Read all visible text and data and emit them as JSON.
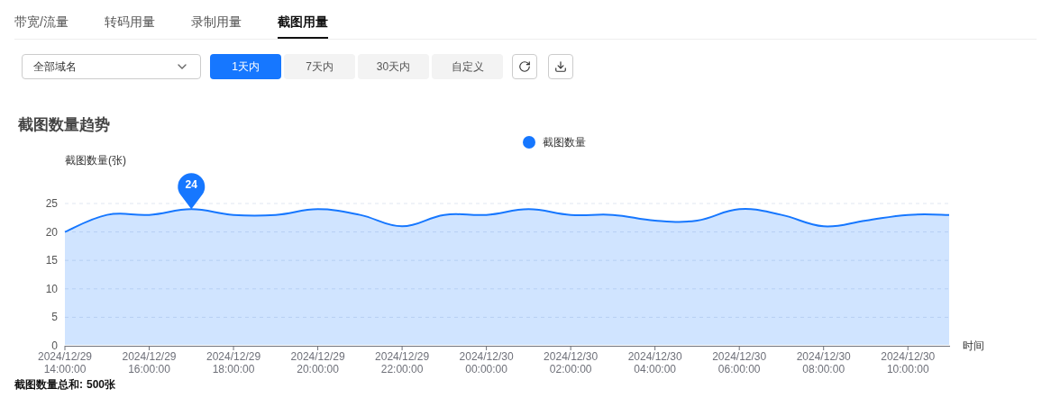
{
  "tabs": [
    {
      "label": "带宽/流量",
      "selected": false
    },
    {
      "label": "转码用量",
      "selected": false
    },
    {
      "label": "录制用量",
      "selected": false
    },
    {
      "label": "截图用量",
      "selected": true
    }
  ],
  "filters": {
    "domain_select": {
      "value": "全部域名"
    },
    "ranges": [
      {
        "label": "1天内",
        "selected": true
      },
      {
        "label": "7天内",
        "selected": false
      },
      {
        "label": "30天内",
        "selected": false
      },
      {
        "label": "自定义",
        "selected": false
      }
    ]
  },
  "chart_section": {
    "title": "截图数量趋势",
    "chart_data": {
      "type": "area",
      "ylabel": "截图数量(张)",
      "xlabel": "时间",
      "categories": [
        "2024/12/29 14:00:00",
        null,
        "2024/12/29 16:00:00",
        null,
        "2024/12/29 18:00:00",
        null,
        "2024/12/29 20:00:00",
        null,
        "2024/12/29 22:00:00",
        null,
        "2024/12/30 00:00:00",
        null,
        "2024/12/30 02:00:00",
        null,
        "2024/12/30 04:00:00",
        null,
        "2024/12/30 06:00:00",
        null,
        "2024/12/30 08:00:00",
        null,
        "2024/12/30 10:00:00",
        null
      ],
      "series": [
        {
          "name": "截图数量",
          "color": "#1677ff",
          "values": [
            20,
            23,
            23,
            24,
            23,
            23,
            24,
            23,
            21,
            23,
            23,
            24,
            23,
            23,
            22,
            22,
            24,
            23,
            21,
            22,
            23,
            23
          ]
        }
      ],
      "grid": true,
      "ylim": [
        0,
        25
      ],
      "yticks": [
        0,
        5,
        10,
        15,
        20,
        25
      ],
      "annotations": [
        {
          "y": 24,
          "text": "24"
        }
      ]
    },
    "total": {
      "label": "截图数量总和:",
      "value": "500张"
    }
  }
}
